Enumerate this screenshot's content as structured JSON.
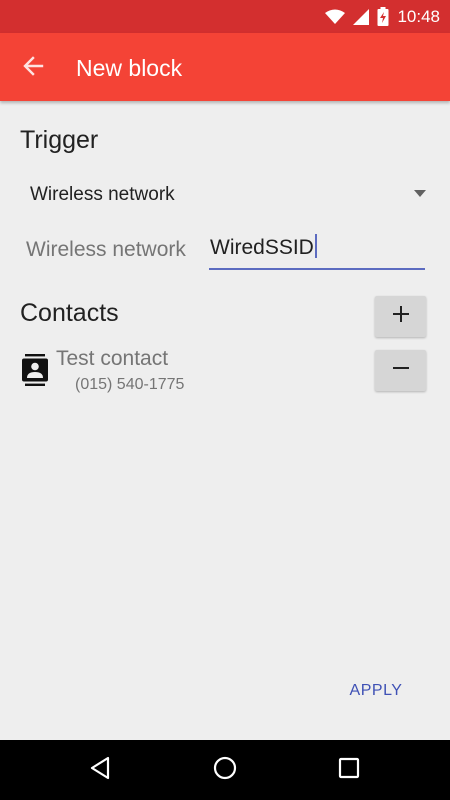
{
  "status_bar": {
    "time": "10:48",
    "icons": [
      "wifi-icon",
      "signal-icon",
      "battery-charging-icon"
    ]
  },
  "app_bar": {
    "title": "New block",
    "back_icon": "arrow-back-icon"
  },
  "trigger": {
    "heading": "Trigger",
    "type_selected": "Wireless network",
    "network_label": "Wireless network",
    "network_value": "WiredSSID"
  },
  "contacts": {
    "heading": "Contacts",
    "add_icon": "plus-icon",
    "items": [
      {
        "name": "Test contact",
        "phone": "(015) 540-1775",
        "icon": "contact-card-icon",
        "remove_icon": "minus-icon"
      }
    ]
  },
  "actions": {
    "apply_label": "APPLY"
  },
  "colors": {
    "status_bar": "#d32f2f",
    "app_bar": "#f44336",
    "accent": "#3f51b5",
    "background": "#eeeeee"
  }
}
